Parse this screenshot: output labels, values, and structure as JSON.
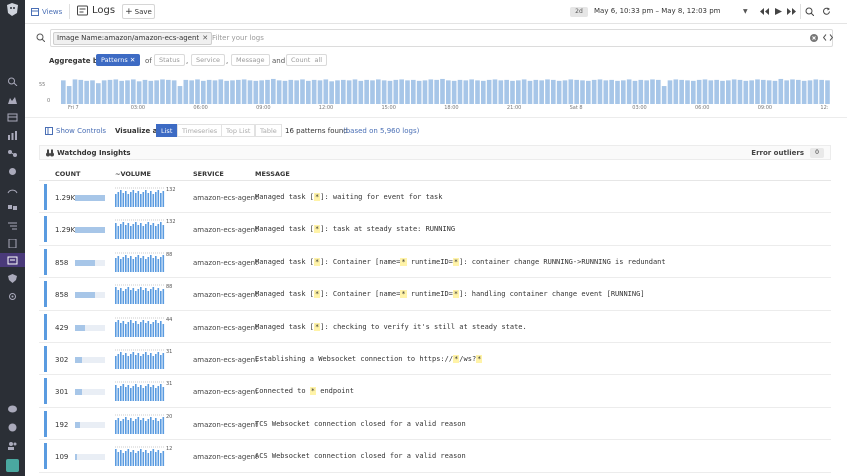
{
  "topbar": {
    "views_label": "Views",
    "title": "Logs",
    "save_label": "Save",
    "range_badge": "2d",
    "range_text": "May 6, 10:33 pm – May 8, 12:03 pm"
  },
  "search": {
    "chip_label": "Image Name:amazon/amazon-ecs-agent",
    "placeholder": "Filter your logs"
  },
  "aggregate": {
    "label": "Aggregate by",
    "patterns": "Patterns",
    "of": "of",
    "status": "Status",
    "service": "Service",
    "message": "Message",
    "and": "and",
    "count": "Count",
    "all": "all"
  },
  "histogram": {
    "y_max_label": "55",
    "y_min_label": "0",
    "x_labels": [
      "Fri 7",
      "03:00",
      "06:00",
      "09:00",
      "12:00",
      "15:00",
      "18:00",
      "21:00",
      "Sat 8",
      "03:00",
      "06:00",
      "09:00",
      "12:"
    ],
    "values": [
      50,
      38,
      52,
      51,
      49,
      50,
      44,
      50,
      51,
      52,
      49,
      50,
      52,
      48,
      51,
      49,
      50,
      52,
      51,
      50,
      38,
      51,
      50,
      52,
      49,
      51,
      50,
      52,
      49,
      50,
      51,
      52,
      50,
      49,
      50,
      51,
      53,
      50,
      49,
      51,
      50,
      52,
      49,
      51,
      50,
      52,
      48,
      50,
      51,
      50,
      52,
      49,
      51,
      50,
      52,
      50,
      49,
      51,
      52,
      50,
      51,
      49,
      50,
      52,
      51,
      53,
      50,
      49,
      51,
      50,
      52,
      50,
      49,
      51,
      52,
      50,
      51,
      49,
      50,
      52,
      49,
      51,
      50,
      52,
      51,
      49,
      50,
      52,
      51,
      50,
      49,
      51,
      52,
      50,
      51,
      49,
      50,
      52,
      49,
      51,
      50,
      52,
      51,
      38,
      50,
      52,
      51,
      50,
      49,
      51,
      52,
      50,
      51,
      49,
      50,
      52,
      51,
      49,
      50,
      52,
      51,
      50,
      49,
      53,
      50,
      52,
      51,
      49,
      50,
      52,
      51,
      50
    ]
  },
  "viz": {
    "show_controls": "Show Controls",
    "label": "Visualize as",
    "tabs": [
      "List",
      "Timeseries",
      "Top List",
      "Table"
    ],
    "patterns_found": "16 patterns found",
    "based_on": "(based on 5,960 logs)"
  },
  "watchdog": {
    "title": "Watchdog Insights",
    "error_outliers": "Error outliers",
    "error_count": "0"
  },
  "table": {
    "headers": [
      "COUNT",
      "~VOLUME",
      "SERVICE",
      "MESSAGE"
    ],
    "rows": [
      {
        "count": "1.29K",
        "fill": 1.0,
        "peak": "132",
        "service": "amazon-ecs-agent",
        "msg": [
          "Managed task [",
          "*",
          "]: waiting for event for task"
        ]
      },
      {
        "count": "1.29K",
        "fill": 1.0,
        "peak": "132",
        "service": "amazon-ecs-agent",
        "msg": [
          "Managed task [",
          "*",
          "]: task at steady state: RUNNING"
        ]
      },
      {
        "count": "858",
        "fill": 0.66,
        "peak": "88",
        "service": "amazon-ecs-agent",
        "msg": [
          "Managed task [",
          "*",
          "]: Container [name=",
          "*",
          " runtimeID=",
          "*",
          "]: container change RUNNING->RUNNING is redundant"
        ]
      },
      {
        "count": "858",
        "fill": 0.66,
        "peak": "88",
        "service": "amazon-ecs-agent",
        "msg": [
          "Managed task [",
          "*",
          "]: Container [name=",
          "*",
          " runtimeID=",
          "*",
          "]: handling container change event [RUNNING]"
        ]
      },
      {
        "count": "429",
        "fill": 0.33,
        "peak": "44",
        "service": "amazon-ecs-agent",
        "msg": [
          "Managed task [",
          "*",
          "]: checking to verify it's still at steady state."
        ]
      },
      {
        "count": "302",
        "fill": 0.23,
        "peak": "31",
        "service": "amazon-ecs-agent",
        "msg": [
          "Establishing a Websocket connection to https://",
          "*",
          "/ws?",
          "*"
        ]
      },
      {
        "count": "301",
        "fill": 0.23,
        "peak": "31",
        "service": "amazon-ecs-agent",
        "msg": [
          "Connected to ",
          "*",
          " endpoint"
        ]
      },
      {
        "count": "192",
        "fill": 0.15,
        "peak": "20",
        "service": "amazon-ecs-agent",
        "msg": [
          "TCS Websocket connection closed for a valid reason"
        ]
      },
      {
        "count": "109",
        "fill": 0.08,
        "peak": "12",
        "service": "amazon-ecs-agent",
        "msg": [
          "ACS Websocket connection closed for a valid reason"
        ]
      }
    ]
  },
  "colors": {
    "accent": "#3d6bc4",
    "sidebar": "#2b2f36",
    "bar": "#a7c6e8",
    "marker": "#5a9be0",
    "highlight": "#fff3a8"
  }
}
